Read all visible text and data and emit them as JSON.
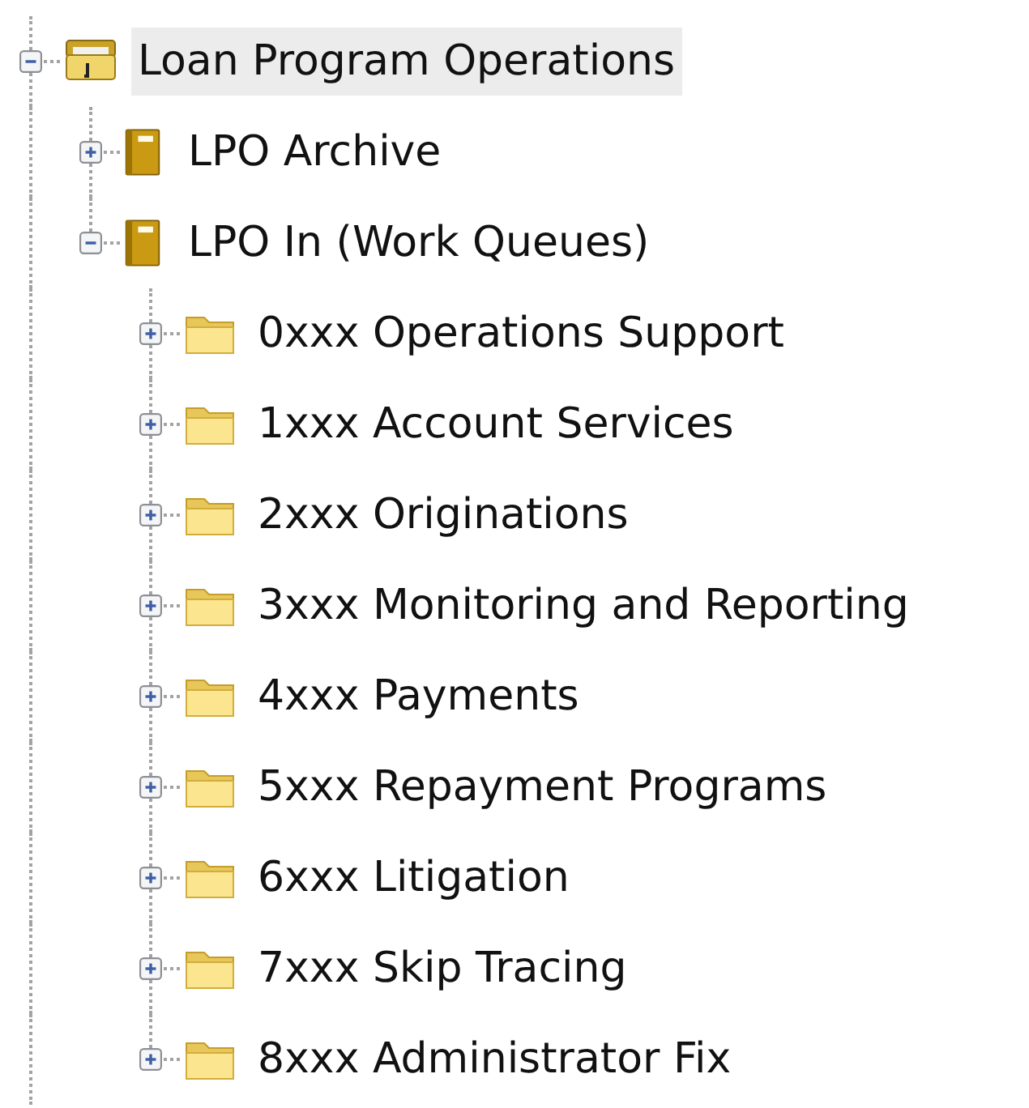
{
  "tree": [
    {
      "label": "Loan Program Operations",
      "kind": "cabinet",
      "expanded": true,
      "selected": true,
      "children": [
        {
          "label": "LPO Archive",
          "kind": "book",
          "expanded": false,
          "selected": false
        },
        {
          "label": "LPO In (Work Queues)",
          "kind": "book",
          "expanded": true,
          "selected": false,
          "children": [
            {
              "label": "0xxx Operations Support",
              "kind": "folder",
              "expanded": false,
              "selected": false
            },
            {
              "label": "1xxx Account Services",
              "kind": "folder",
              "expanded": false,
              "selected": false
            },
            {
              "label": "2xxx Originations",
              "kind": "folder",
              "expanded": false,
              "selected": false
            },
            {
              "label": "3xxx Monitoring and Reporting",
              "kind": "folder",
              "expanded": false,
              "selected": false
            },
            {
              "label": "4xxx Payments",
              "kind": "folder",
              "expanded": false,
              "selected": false
            },
            {
              "label": "5xxx Repayment Programs",
              "kind": "folder",
              "expanded": false,
              "selected": false
            },
            {
              "label": "6xxx Litigation",
              "kind": "folder",
              "expanded": false,
              "selected": false
            },
            {
              "label": "7xxx Skip Tracing",
              "kind": "folder",
              "expanded": false,
              "selected": false
            },
            {
              "label": "8xxx Administrator Fix",
              "kind": "folder",
              "expanded": false,
              "selected": false
            }
          ]
        }
      ]
    }
  ]
}
